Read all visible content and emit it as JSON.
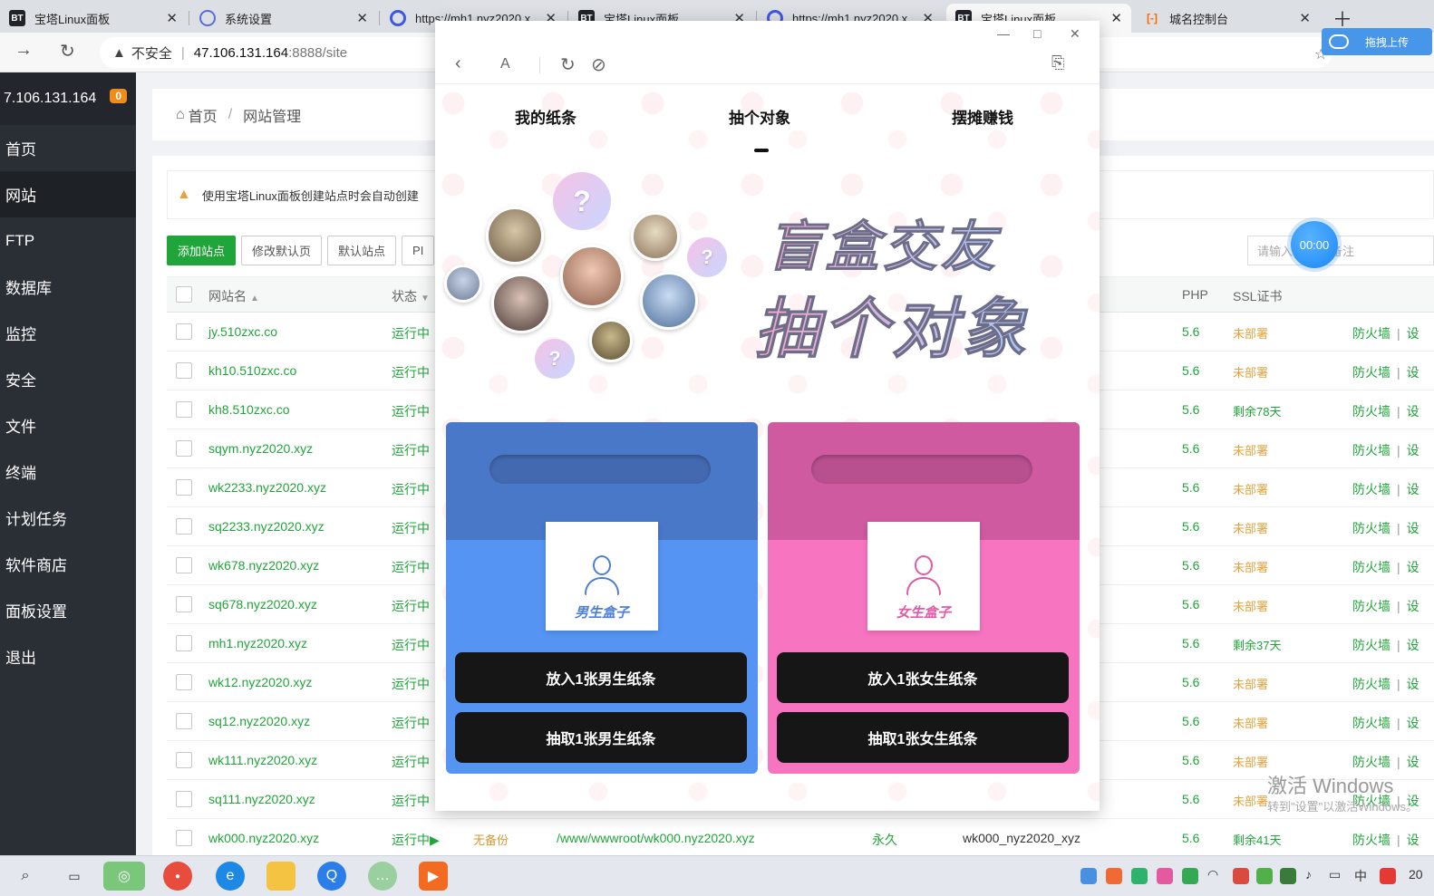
{
  "browser": {
    "tabs": [
      {
        "label": "宝塔Linux面板",
        "favicon": "bt-logo-icon"
      },
      {
        "label": "系统设置",
        "favicon": "gear-icon"
      },
      {
        "label": "https://mh1.nyz2020.x",
        "favicon": "ring-icon"
      },
      {
        "label": "宝塔Linux面板",
        "favicon": "bt-logo-icon"
      },
      {
        "label": "https://mh1.nyz2020.x",
        "favicon": "ring-icon"
      },
      {
        "label": "宝塔Linux面板",
        "favicon": "bt-logo-icon"
      },
      {
        "label": "城名控制台",
        "favicon": "aliyun-icon"
      }
    ],
    "active_tab": 5,
    "address": {
      "insecure_label": "不安全",
      "host": "47.106.131.164",
      "path": ":8888/site"
    },
    "upload_button": "拖拽上传"
  },
  "sidebar": {
    "host": "7.106.131.164",
    "badge": "0",
    "items": [
      "首页",
      "网站",
      "FTP",
      "数据库",
      "监控",
      "安全",
      "文件",
      "终端",
      "计划任务",
      "软件商店",
      "面板设置",
      "退出"
    ],
    "active": "网站"
  },
  "breadcrumb": {
    "home": "首页",
    "current": "网站管理"
  },
  "notice": "使用宝塔Linux面板创建站点时会自动创建",
  "toolbar": {
    "add_site": "添加站点",
    "edit_default": "修改默认页",
    "default_site": "默认站点",
    "php_btn": "PI"
  },
  "search": {
    "placeholder_left": "请输入",
    "placeholder_right": "备注"
  },
  "timer": "00:00",
  "table": {
    "headers": {
      "name": "网站名",
      "status": "状态",
      "php": "PHP",
      "ssl": "SSL证书"
    },
    "rows": [
      {
        "name": "jy.510zxc.co",
        "status": "运行中",
        "php": "5.6",
        "ssl": "未部署",
        "ssl_ok": false
      },
      {
        "name": "kh10.510zxc.co",
        "status": "运行中",
        "php": "5.6",
        "ssl": "未部署",
        "ssl_ok": false
      },
      {
        "name": "kh8.510zxc.co",
        "status": "运行中",
        "php": "5.6",
        "ssl": "剩余78天",
        "ssl_ok": true
      },
      {
        "name": "sqym.nyz2020.xyz",
        "status": "运行中",
        "php": "5.6",
        "ssl": "未部署",
        "ssl_ok": false
      },
      {
        "name": "wk2233.nyz2020.xyz",
        "status": "运行中",
        "php": "5.6",
        "ssl": "未部署",
        "ssl_ok": false
      },
      {
        "name": "sq2233.nyz2020.xyz",
        "status": "运行中",
        "php": "5.6",
        "ssl": "未部署",
        "ssl_ok": false
      },
      {
        "name": "wk678.nyz2020.xyz",
        "status": "运行中",
        "php": "5.6",
        "ssl": "未部署",
        "ssl_ok": false
      },
      {
        "name": "sq678.nyz2020.xyz",
        "status": "运行中",
        "php": "5.6",
        "ssl": "未部署",
        "ssl_ok": false
      },
      {
        "name": "mh1.nyz2020.xyz",
        "status": "运行中",
        "php": "5.6",
        "ssl": "剩余37天",
        "ssl_ok": true
      },
      {
        "name": "wk12.nyz2020.xyz",
        "status": "运行中",
        "php": "5.6",
        "ssl": "未部署",
        "ssl_ok": false
      },
      {
        "name": "sq12.nyz2020.xyz",
        "status": "运行中",
        "php": "5.6",
        "ssl": "未部署",
        "ssl_ok": false
      },
      {
        "name": "wk111.nyz2020.xyz",
        "status": "运行中",
        "php": "5.6",
        "ssl": "未部署",
        "ssl_ok": false
      },
      {
        "name": "sq111.nyz2020.xyz",
        "status": "运行中",
        "php": "5.6",
        "ssl": "未部署",
        "ssl_ok": false
      },
      {
        "name": "wk000.nyz2020.xyz",
        "status": "运行中▶",
        "backup": "无备份",
        "path": "/www/wwwroot/wk000.nyz2020.xyz",
        "expire": "永久",
        "note": "wk000_nyz2020_xyz",
        "php": "5.6",
        "ssl": "剩余41天",
        "ssl_ok": true
      }
    ],
    "op_firewall": "防火墙",
    "op_settings": "设"
  },
  "watermark": {
    "line1": "激活 Windows",
    "line2": "转到\"设置\"以激活Windows。"
  },
  "popup": {
    "tabs": {
      "left": "我的纸条",
      "center": "抽个对象",
      "right": "摆摊赚钱"
    },
    "hero": {
      "line1": "盲盒交友",
      "line2": "抽个对象"
    },
    "male": {
      "card_label": "男生盒子",
      "put": "放入1张男生纸条",
      "draw": "抽取1张男生纸条"
    },
    "female": {
      "card_label": "女生盒子",
      "put": "放入1张女生纸条",
      "draw": "抽取1张女生纸条"
    },
    "question_mark": "?"
  },
  "taskbar": {
    "tray_ime": "中",
    "tray_clock": "20"
  },
  "colors": {
    "panel_green": "#20a53a",
    "male_blue": "#5594f2",
    "female_pink": "#f774c0",
    "sidebar_bg": "#2a2e35"
  }
}
